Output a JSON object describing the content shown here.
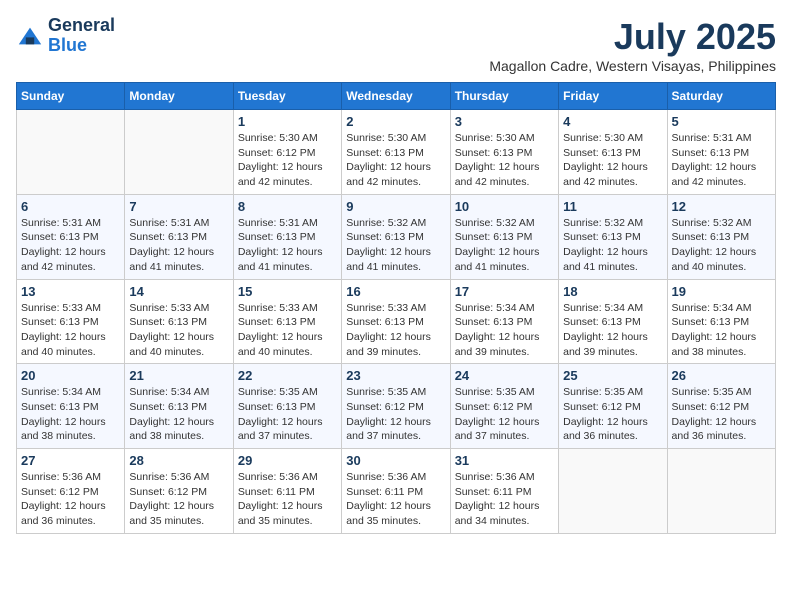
{
  "header": {
    "logo_line1": "General",
    "logo_line2": "Blue",
    "month_year": "July 2025",
    "location": "Magallon Cadre, Western Visayas, Philippines"
  },
  "weekdays": [
    "Sunday",
    "Monday",
    "Tuesday",
    "Wednesday",
    "Thursday",
    "Friday",
    "Saturday"
  ],
  "weeks": [
    [
      {
        "day": "",
        "info": ""
      },
      {
        "day": "",
        "info": ""
      },
      {
        "day": "1",
        "info": "Sunrise: 5:30 AM\nSunset: 6:12 PM\nDaylight: 12 hours\nand 42 minutes."
      },
      {
        "day": "2",
        "info": "Sunrise: 5:30 AM\nSunset: 6:13 PM\nDaylight: 12 hours\nand 42 minutes."
      },
      {
        "day": "3",
        "info": "Sunrise: 5:30 AM\nSunset: 6:13 PM\nDaylight: 12 hours\nand 42 minutes."
      },
      {
        "day": "4",
        "info": "Sunrise: 5:30 AM\nSunset: 6:13 PM\nDaylight: 12 hours\nand 42 minutes."
      },
      {
        "day": "5",
        "info": "Sunrise: 5:31 AM\nSunset: 6:13 PM\nDaylight: 12 hours\nand 42 minutes."
      }
    ],
    [
      {
        "day": "6",
        "info": "Sunrise: 5:31 AM\nSunset: 6:13 PM\nDaylight: 12 hours\nand 42 minutes."
      },
      {
        "day": "7",
        "info": "Sunrise: 5:31 AM\nSunset: 6:13 PM\nDaylight: 12 hours\nand 41 minutes."
      },
      {
        "day": "8",
        "info": "Sunrise: 5:31 AM\nSunset: 6:13 PM\nDaylight: 12 hours\nand 41 minutes."
      },
      {
        "day": "9",
        "info": "Sunrise: 5:32 AM\nSunset: 6:13 PM\nDaylight: 12 hours\nand 41 minutes."
      },
      {
        "day": "10",
        "info": "Sunrise: 5:32 AM\nSunset: 6:13 PM\nDaylight: 12 hours\nand 41 minutes."
      },
      {
        "day": "11",
        "info": "Sunrise: 5:32 AM\nSunset: 6:13 PM\nDaylight: 12 hours\nand 41 minutes."
      },
      {
        "day": "12",
        "info": "Sunrise: 5:32 AM\nSunset: 6:13 PM\nDaylight: 12 hours\nand 40 minutes."
      }
    ],
    [
      {
        "day": "13",
        "info": "Sunrise: 5:33 AM\nSunset: 6:13 PM\nDaylight: 12 hours\nand 40 minutes."
      },
      {
        "day": "14",
        "info": "Sunrise: 5:33 AM\nSunset: 6:13 PM\nDaylight: 12 hours\nand 40 minutes."
      },
      {
        "day": "15",
        "info": "Sunrise: 5:33 AM\nSunset: 6:13 PM\nDaylight: 12 hours\nand 40 minutes."
      },
      {
        "day": "16",
        "info": "Sunrise: 5:33 AM\nSunset: 6:13 PM\nDaylight: 12 hours\nand 39 minutes."
      },
      {
        "day": "17",
        "info": "Sunrise: 5:34 AM\nSunset: 6:13 PM\nDaylight: 12 hours\nand 39 minutes."
      },
      {
        "day": "18",
        "info": "Sunrise: 5:34 AM\nSunset: 6:13 PM\nDaylight: 12 hours\nand 39 minutes."
      },
      {
        "day": "19",
        "info": "Sunrise: 5:34 AM\nSunset: 6:13 PM\nDaylight: 12 hours\nand 38 minutes."
      }
    ],
    [
      {
        "day": "20",
        "info": "Sunrise: 5:34 AM\nSunset: 6:13 PM\nDaylight: 12 hours\nand 38 minutes."
      },
      {
        "day": "21",
        "info": "Sunrise: 5:34 AM\nSunset: 6:13 PM\nDaylight: 12 hours\nand 38 minutes."
      },
      {
        "day": "22",
        "info": "Sunrise: 5:35 AM\nSunset: 6:13 PM\nDaylight: 12 hours\nand 37 minutes."
      },
      {
        "day": "23",
        "info": "Sunrise: 5:35 AM\nSunset: 6:12 PM\nDaylight: 12 hours\nand 37 minutes."
      },
      {
        "day": "24",
        "info": "Sunrise: 5:35 AM\nSunset: 6:12 PM\nDaylight: 12 hours\nand 37 minutes."
      },
      {
        "day": "25",
        "info": "Sunrise: 5:35 AM\nSunset: 6:12 PM\nDaylight: 12 hours\nand 36 minutes."
      },
      {
        "day": "26",
        "info": "Sunrise: 5:35 AM\nSunset: 6:12 PM\nDaylight: 12 hours\nand 36 minutes."
      }
    ],
    [
      {
        "day": "27",
        "info": "Sunrise: 5:36 AM\nSunset: 6:12 PM\nDaylight: 12 hours\nand 36 minutes."
      },
      {
        "day": "28",
        "info": "Sunrise: 5:36 AM\nSunset: 6:12 PM\nDaylight: 12 hours\nand 35 minutes."
      },
      {
        "day": "29",
        "info": "Sunrise: 5:36 AM\nSunset: 6:11 PM\nDaylight: 12 hours\nand 35 minutes."
      },
      {
        "day": "30",
        "info": "Sunrise: 5:36 AM\nSunset: 6:11 PM\nDaylight: 12 hours\nand 35 minutes."
      },
      {
        "day": "31",
        "info": "Sunrise: 5:36 AM\nSunset: 6:11 PM\nDaylight: 12 hours\nand 34 minutes."
      },
      {
        "day": "",
        "info": ""
      },
      {
        "day": "",
        "info": ""
      }
    ]
  ]
}
